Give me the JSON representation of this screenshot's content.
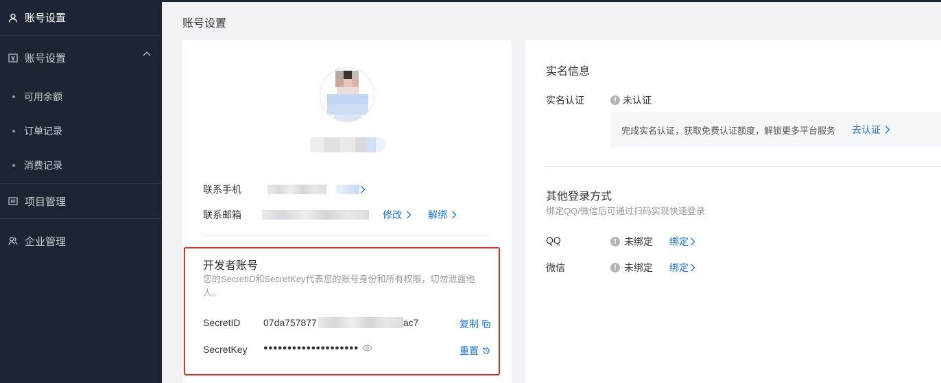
{
  "sidebar": {
    "top_label": "账号设置",
    "group_label": "账号设置",
    "sub_items": [
      "可用余额",
      "订单记录",
      "消费记录"
    ],
    "project_label": "项目管理",
    "enterprise_label": "企业管理"
  },
  "page": {
    "title": "账号设置"
  },
  "profile": {
    "phone_label": "联系手机",
    "email_label": "联系邮箱",
    "modify_label": "修改",
    "unbind_label": "解绑"
  },
  "developer": {
    "title": "开发者账号",
    "description": "您的SecretID和SecretKey代表您的账号身份和所有权限，切勿泄露他人。",
    "secret_id_label": "SecretID",
    "secret_id_prefix": "07da757877",
    "secret_id_suffix": "ac7",
    "secret_key_label": "SecretKey",
    "secret_key_masked": "●●●●●●●●●●●●●●●●●●●●",
    "copy_label": "复制",
    "reset_label": "重置"
  },
  "realname": {
    "title": "实名信息",
    "label": "实名认证",
    "status": "未认证",
    "notice": "完成实名认证，获取免费认证额度，解锁更多平台服务",
    "action": "去认证"
  },
  "other_login": {
    "title": "其他登录方式",
    "subtitle": "绑定QQ/微信后可通过扫码实现快速登录",
    "qq_label": "QQ",
    "qq_status": "未绑定",
    "wechat_label": "微信",
    "wechat_status": "未绑定",
    "bind_label": "绑定"
  },
  "colors": {
    "sidebar_bg": "#1d2433",
    "link": "#1677e5",
    "highlight_border": "#e02b2b"
  }
}
